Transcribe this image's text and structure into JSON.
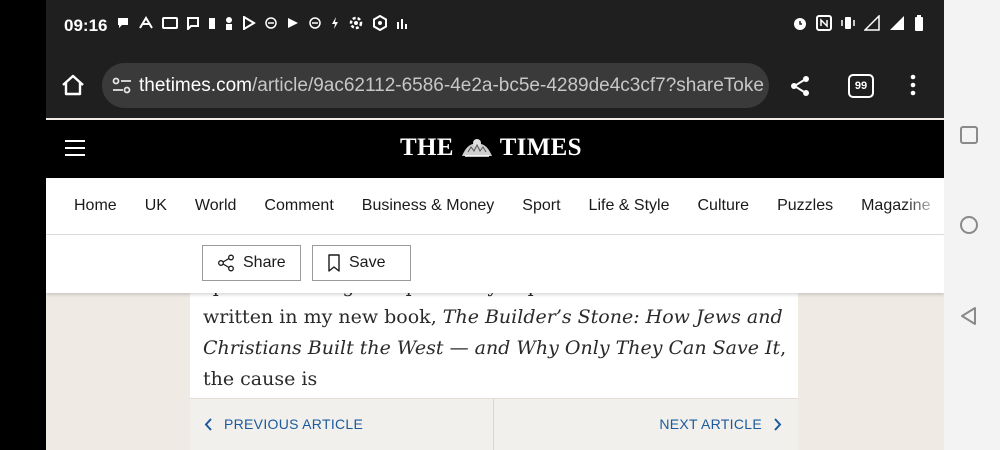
{
  "status_bar": {
    "time": "09:16"
  },
  "browser": {
    "url_host": "thetimes.com",
    "url_path": "/article/9ac62112-6586-4e2a-bc5e-4289de4c3cf7?shareToke",
    "tab_count": "99"
  },
  "site": {
    "logo_left": "THE",
    "logo_right": "TIMES",
    "nav": [
      "Home",
      "UK",
      "World",
      "Comment",
      "Business & Money",
      "Sport",
      "Life & Style",
      "Culture",
      "Puzzles",
      "Magazine"
    ]
  },
  "actions": {
    "share_label": "Share",
    "save_label": "Save"
  },
  "article": {
    "text_1": "specific messages imparted by Pope Francis. As I have written in my new book, ",
    "book_title": "The Builder’s Stone: How Jews and Christians Built the West — and Why Only They Can Save It",
    "text_2": ", the cause is"
  },
  "pager": {
    "previous_label": "PREVIOUS ARTICLE",
    "next_label": "NEXT ARTICLE"
  },
  "colors": {
    "link": "#1b5a9c",
    "header_bg": "#000000",
    "browser_bg": "#1f1f1f"
  }
}
